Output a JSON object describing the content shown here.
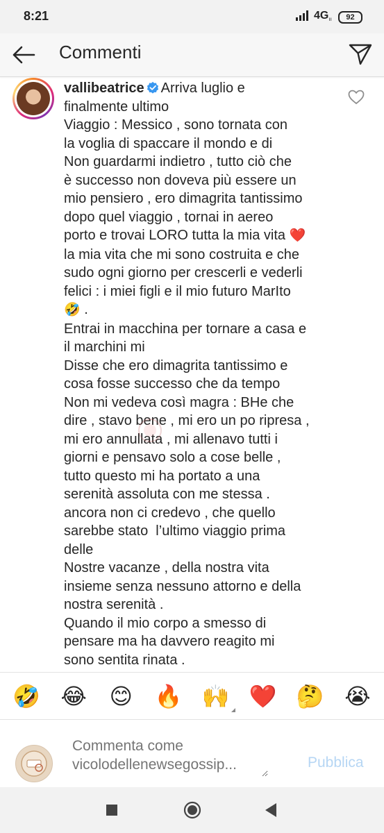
{
  "status_bar": {
    "time": "8:21",
    "network": "4G",
    "network_sub": "ıı",
    "battery": "92"
  },
  "header": {
    "title": "Commenti",
    "back_icon": "arrow-left-icon",
    "send_icon": "paper-plane-icon"
  },
  "comment": {
    "username": "vallibeatrice",
    "verified_icon": "verified-badge-icon",
    "text_part1": "Arriva luglio e\nfinalmente ultimo\nViaggio : Messico , sono tornata con\nla voglia di spaccare il mondo e di\nNon guardarmi indietro , tutto ciò che\nè successo non doveva più essere un\nmio pensiero , ero dimagrita tantissimo\ndopo quel viaggio , tornai in aereo\nporto e trovai LORO tutta la mia vita ",
    "heart_emoji": "❤️",
    "text_part2": "\nla mia vita che mi sono costruita e che\nsudo ogni giorno per crescerli e vederli\nfelici : i miei figli e il mio futuro MarIto\n",
    "laugh_emoji": "🤣",
    "text_part3": " .\nEntrai in macchina per tornare a casa e\nil marchini mi\nDisse che ero dimagrita tantissimo e\ncosa fosse successo che da tempo\nNon mi vedeva così magra : BHe che\ndire , stavo bene , mi ero un po ripresa ,\nmi ero annullata , mi allenavo tutti i\ngiorni e pensavo solo a cose belle ,\ntutto questo mi ha portato a una\nserenità assoluta con me stessa .\nancora non ci credevo , che quello\nsarebbe stato  l’ultimo viaggio prima\ndelle\nNostre vacanze , della nostra vita\ninsieme senza nessuno attorno e della\nnostra serenità .\nQuando il mio corpo a smesso di\npensare ma ha davvero reagito mi\nsono sentita rinata .",
    "like_icon": "heart-outline-icon"
  },
  "emoji_bar": [
    {
      "emoji": "🤣",
      "name": "rofl-emoji"
    },
    {
      "emoji": "😂",
      "name": "joy-emoji"
    },
    {
      "emoji": "😊",
      "name": "smile-emoji"
    },
    {
      "emoji": "🔥",
      "name": "fire-emoji"
    },
    {
      "emoji": "🙌",
      "name": "raised-hands-emoji"
    },
    {
      "emoji": "❤️",
      "name": "heart-emoji"
    },
    {
      "emoji": "🤔",
      "name": "thinking-emoji"
    },
    {
      "emoji": "😭",
      "name": "crying-emoji"
    }
  ],
  "composer": {
    "placeholder": "Commenta come\nvicolodellenewsegossip...",
    "publish_label": "Pubblica"
  },
  "nav_bar": {
    "recents_icon": "square-icon",
    "home_icon": "circle-icon",
    "back_icon": "triangle-back-icon"
  }
}
